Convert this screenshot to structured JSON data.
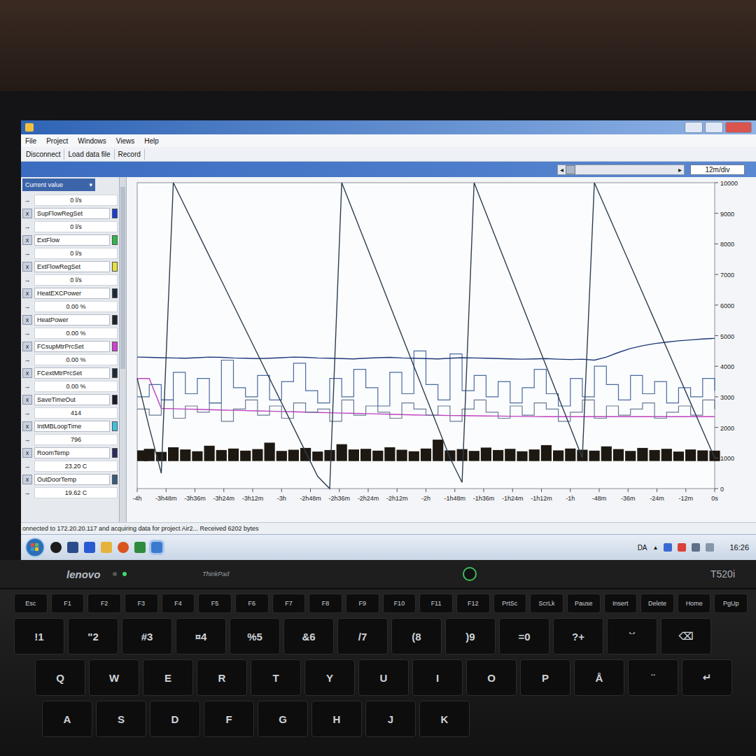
{
  "window": {
    "menu": [
      "File",
      "Project",
      "Windows",
      "Views",
      "Help"
    ],
    "toolbar": [
      "Disconnect",
      "Load data file",
      "Record"
    ],
    "scroll_left": "◂",
    "scroll_right": "▸",
    "scale": "12m/div"
  },
  "signals_panel": {
    "dropdown": "Current value",
    "caret": "▾",
    "remove_glyph": "x",
    "arrow_glyph": "→",
    "first_value": "0 l/s",
    "signals": [
      {
        "name": "SupFlowRegSet",
        "value": "0 l/s",
        "color": "#1a3ccc"
      },
      {
        "name": "ExtFlow",
        "value": "0 l/s",
        "color": "#2db84a"
      },
      {
        "name": "ExtFlowRegSet",
        "value": "0 l/s",
        "color": "#e6e03a"
      },
      {
        "name": "HeatEXCPower",
        "value": "0.00 %",
        "color": "#1c2a3a"
      },
      {
        "name": "HeatPower",
        "value": "0.00 %",
        "color": "#1c2430"
      },
      {
        "name": "FCsupMtrPrcSet",
        "value": "0.00 %",
        "color": "#d040d0"
      },
      {
        "name": "FCextMtrPrcSet",
        "value": "0.00 %",
        "color": "#1e2a36"
      },
      {
        "name": "SaveTimeOut",
        "value": "414",
        "color": "#1a1a2a"
      },
      {
        "name": "IntMBLoopTime",
        "value": "796",
        "color": "#40c0e0"
      },
      {
        "name": "RoomTemp",
        "value": "23.20 C",
        "color": "#2a2a60"
      },
      {
        "name": "OutDoorTemp",
        "value": "19.62 C",
        "color": "#3a5a7a"
      }
    ]
  },
  "chart": {
    "y_ticks": [
      "10000",
      "9000",
      "8000",
      "7000",
      "6000",
      "5000",
      "4000",
      "3000",
      "2000",
      "1000",
      "0"
    ],
    "x_ticks": [
      "-4h",
      "-3h48m",
      "-3h36m",
      "-3h24m",
      "-3h12m",
      "-3h",
      "-2h48m",
      "-2h36m",
      "-2h24m",
      "-2h12m",
      "-2h",
      "-1h48m",
      "-1h36m",
      "-1h24m",
      "-1h12m",
      "-1h",
      "-48m",
      "-36m",
      "-24m",
      "-12m",
      "0s"
    ],
    "series": [
      {
        "kind": "bars",
        "color": "#1e1812",
        "values": [
          1250,
          1300,
          1200,
          1350,
          1280,
          1220,
          1400,
          1260,
          1310,
          1240,
          1290,
          1500,
          1230,
          1270,
          1330,
          1210,
          1260,
          1450,
          1280,
          1300,
          1240,
          1350,
          1270,
          1220,
          1310,
          1600,
          1250,
          1290,
          1230,
          1340,
          1260,
          1300,
          1220,
          1280,
          1420,
          1250,
          1310,
          1270,
          1240,
          1380,
          1290,
          1230,
          1330,
          1260,
          1300,
          1210,
          1280,
          1250,
          1240
        ]
      },
      {
        "kind": "line",
        "color": "#c040c0",
        "values": [
          3600,
          3600,
          2620,
          2610,
          2600,
          2590,
          2580,
          2570,
          2560,
          2550,
          2540,
          2530,
          2520,
          2510,
          2500,
          2490,
          2480,
          2470,
          2460,
          2450,
          2440,
          2430,
          2420,
          2410,
          2400,
          2395,
          2390,
          2385,
          2380,
          2375,
          2370,
          2365,
          2360,
          2355,
          2350,
          2350,
          2350,
          2350,
          2350,
          2350,
          2350,
          2350,
          2350,
          2350,
          2350,
          2350,
          2350,
          2350,
          2350
        ]
      },
      {
        "kind": "step",
        "color": "#6a7a95",
        "values": [
          2600,
          2400,
          2900,
          2300,
          2700,
          2500,
          2800,
          2200,
          2600,
          2900,
          2400,
          2700,
          2300,
          2800,
          2500,
          2600,
          2200,
          2900,
          2400,
          2700,
          2500,
          2300,
          2800,
          2600,
          2400,
          2700,
          2200,
          2600,
          2900,
          2500,
          2300,
          2700,
          2400,
          2800,
          2600,
          2200,
          2500,
          2900,
          2300,
          2700,
          2400,
          2600,
          2800,
          2300,
          2500,
          2700,
          2400,
          2900,
          2600
        ]
      },
      {
        "kind": "step",
        "color": "#4a6aa0",
        "values": [
          3000,
          3400,
          2900,
          3800,
          3100,
          3600,
          2800,
          4200,
          3300,
          3000,
          3700,
          2900,
          3500,
          4100,
          3200,
          2800,
          3600,
          3000,
          3900,
          3300,
          2700,
          3800,
          3100,
          4500,
          3400,
          2900,
          4400,
          3200,
          3700,
          3000,
          3500,
          2800,
          3300,
          3900,
          3100,
          2700,
          3600,
          3000,
          4000,
          3400,
          2900,
          3700,
          3100,
          3500,
          2800,
          3300,
          3000,
          3600,
          3200
        ]
      },
      {
        "kind": "line",
        "color": "#1f3a7a",
        "values": [
          4300,
          4290,
          4280,
          4270,
          4260,
          4280,
          4300,
          4290,
          4270,
          4260,
          4250,
          4260,
          4280,
          4300,
          4290,
          4270,
          4260,
          4250,
          4240,
          4260,
          4280,
          4290,
          4270,
          4260,
          4250,
          4240,
          4260,
          4280,
          4270,
          4260,
          4250,
          4240,
          4230,
          4240,
          4250,
          4230,
          4220,
          4230,
          4200,
          4300,
          4450,
          4580,
          4670,
          4740,
          4790,
          4830,
          4860,
          4890,
          4910
        ]
      },
      {
        "kind": "line",
        "color": "#2c3e50",
        "values": [
          3600,
          2000,
          500,
          10000,
          9200,
          8400,
          7600,
          6800,
          6000,
          5200,
          4400,
          3600,
          2800,
          2000,
          1200,
          400,
          0,
          10000,
          9000,
          8000,
          7000,
          6000,
          5000,
          4000,
          3000,
          2000,
          1000,
          200,
          10000,
          9000,
          8000,
          7000,
          6000,
          5000,
          4000,
          3000,
          2000,
          1000,
          10000,
          9100,
          8200,
          7300,
          6400,
          5500,
          4600,
          3700,
          2800,
          1900,
          1000
        ]
      }
    ]
  },
  "status_bar": "onnected to 172.20.20.117 and acquiring data for project Air2... Received 6202 bytes",
  "taskbar": {
    "language": "DA",
    "tray_arrow": "▲",
    "time": "16:26"
  },
  "laptop": {
    "brand": "lenovo",
    "series": "ThinkPad",
    "model": "T520i",
    "keyboard": [
      [
        "Esc",
        "F1",
        "F2",
        "F3",
        "F4",
        "F5",
        "F6",
        "F7",
        "F8",
        "F9",
        "F10",
        "F11",
        "F12",
        "PrtSc",
        "ScrLk",
        "Pause",
        "Insert",
        "Delete",
        "Home",
        "PgUp"
      ],
      [
        "!1",
        "\"2",
        "#3",
        "¤4",
        "%5",
        "&6",
        "/7",
        "(8",
        ")9",
        "=0",
        "?+",
        "`´",
        "⌫"
      ],
      [
        "Q",
        "W",
        "E",
        "R",
        "T",
        "Y",
        "U",
        "I",
        "O",
        "P",
        "Å",
        "¨",
        "↵"
      ],
      [
        "A",
        "S",
        "D",
        "F",
        "G",
        "H",
        "J",
        "K"
      ]
    ]
  }
}
